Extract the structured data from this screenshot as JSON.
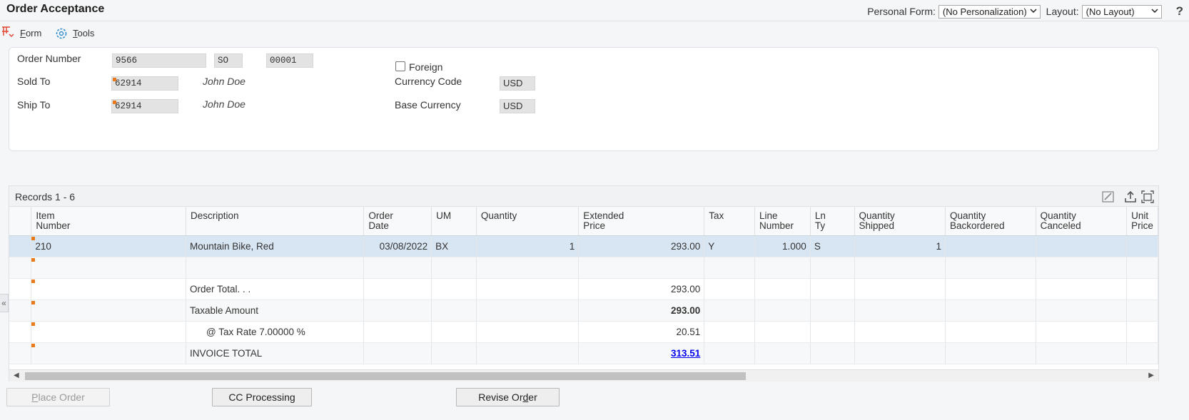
{
  "app": {
    "title": "Order Acceptance"
  },
  "personalization": {
    "personal_form_label": "Personal Form:",
    "personal_form_value": "(No Personalization)",
    "layout_label": "Layout:",
    "layout_value": "(No Layout)",
    "help": "?"
  },
  "menu": {
    "form": {
      "prefix": "F",
      "rest": "orm",
      "icon": "form-icon"
    },
    "tools": {
      "prefix": "T",
      "rest": "ools",
      "icon": "gear-icon"
    }
  },
  "header": {
    "order_number_label": "Order Number",
    "order_number": "9566",
    "order_type": "SO",
    "order_company": "00001",
    "sold_to_label": "Sold To",
    "sold_to": "62914",
    "sold_to_name": "John Doe",
    "ship_to_label": "Ship To",
    "ship_to": "62914",
    "ship_to_name": "John Doe",
    "foreign_label": "Foreign",
    "foreign_checked": false,
    "currency_code_label": "Currency Code",
    "currency_code": "USD",
    "base_currency_label": "Base Currency",
    "base_currency": "USD"
  },
  "grid": {
    "records_label": "Records 1 - 6",
    "columns": [
      "",
      "Item\nNumber",
      "Description",
      "Order\nDate",
      "UM",
      "Quantity",
      "Extended\nPrice",
      "Tax",
      "Line\nNumber",
      "Ln\nTy",
      "Quantity\nShipped",
      "Quantity\nBackordered",
      "Quantity\nCanceled",
      "Unit\nPrice"
    ],
    "rows": {
      "r1": {
        "item_number": "210",
        "description": "Mountain Bike, Red",
        "order_date": "03/08/2022",
        "um": "BX",
        "quantity": "1",
        "extended_price": "293.00",
        "tax": "Y",
        "line_number": "1.000",
        "line_type": "S",
        "quantity_shipped": "1"
      },
      "order_total_label": "Order Total. . .",
      "order_total": "293.00",
      "taxable_label": "Taxable Amount",
      "taxable_amount": "293.00",
      "tax_rate_label": "@ Tax Rate 7.00000 %",
      "tax_amount": "20.51",
      "invoice_label": "INVOICE TOTAL",
      "invoice_total": "313.51"
    }
  },
  "sidebar_toggle": "«",
  "buttons": {
    "place_order": {
      "prefix": "P",
      "rest": "lace Order"
    },
    "cc_processing": {
      "prefix": "CC Processing",
      "rest": ""
    },
    "revise_order": {
      "prefix": "Revise Or",
      "u": "d",
      "rest": "er"
    }
  },
  "colors": {
    "accent_flag": "#ea7b1d",
    "selected_row": "#d8e6f3",
    "negative": "#e00000",
    "link": "#0000ee"
  }
}
